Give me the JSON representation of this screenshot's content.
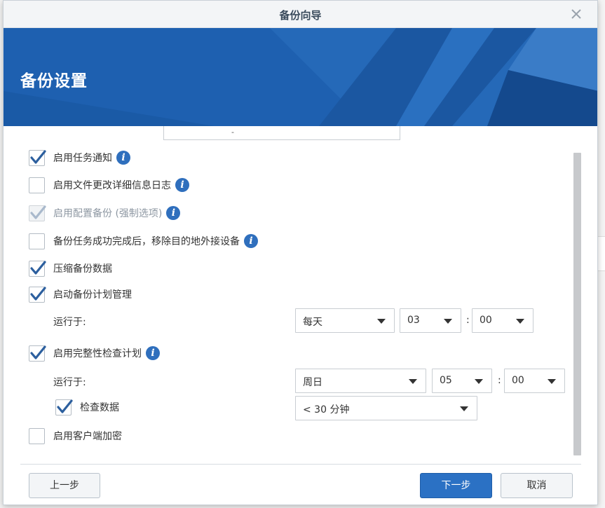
{
  "window": {
    "title": "备份向导",
    "close_icon": "close-icon"
  },
  "banner": {
    "heading": "备份设置"
  },
  "options": [
    {
      "id": "task-notify",
      "label": "启用任务通知",
      "checked": true,
      "disabled": false,
      "info": true
    },
    {
      "id": "file-change-log",
      "label": "启用文件更改详细信息日志",
      "checked": false,
      "disabled": false,
      "info": true
    },
    {
      "id": "config-backup",
      "label": "启用配置备份 (强制选项)",
      "checked": true,
      "disabled": true,
      "info": true
    },
    {
      "id": "remove-external",
      "label": "备份任务成功完成后，移除目的地外接设备",
      "checked": false,
      "disabled": false,
      "info": true
    },
    {
      "id": "compress",
      "label": "压缩备份数据",
      "checked": true,
      "disabled": false,
      "info": false
    },
    {
      "id": "schedule",
      "label": "启动备份计划管理",
      "checked": true,
      "disabled": false,
      "info": false
    },
    {
      "id": "integrity",
      "label": "启用完整性检查计划",
      "checked": true,
      "disabled": false,
      "info": true
    },
    {
      "id": "client-encrypt",
      "label": "启用客户端加密",
      "checked": false,
      "disabled": false,
      "info": false
    }
  ],
  "schedule": {
    "run_label": "运行于:",
    "frequency": "每天",
    "hour": "03",
    "minute": "00",
    "colon": ":"
  },
  "integrity": {
    "run_label": "运行于:",
    "day": "周日",
    "hour": "05",
    "minute": "00",
    "colon": ":",
    "check_data_label": "检查数据",
    "check_data_checked": true,
    "duration": "< 30 分钟"
  },
  "footer": {
    "prev_label": "上一步",
    "next_label": "下一步",
    "cancel_label": "取消"
  },
  "colors": {
    "accent": "#2b71c4",
    "banner": "#1e5fae",
    "check": "#2c5f9e"
  }
}
